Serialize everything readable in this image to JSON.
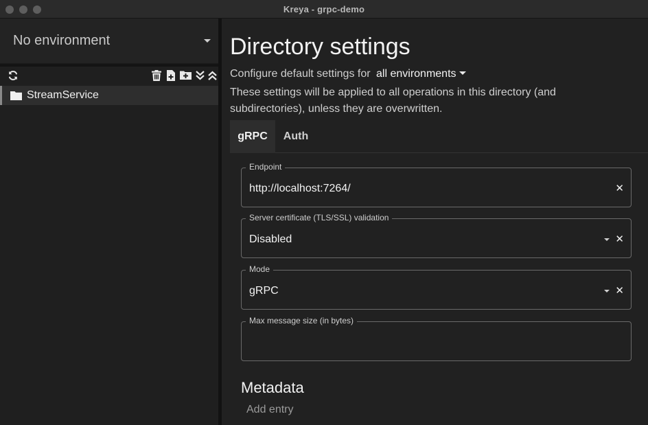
{
  "window": {
    "title": "Kreya - grpc-demo"
  },
  "sidebar": {
    "environment_label": "No environment",
    "toolbar_icons": [
      "refresh-icon",
      "delete-icon",
      "new-file-icon",
      "new-folder-icon",
      "collapse-all-icon",
      "expand-all-icon"
    ],
    "tree": [
      {
        "label": "StreamService",
        "icon": "folder-icon"
      }
    ]
  },
  "main": {
    "title": "Directory settings",
    "configure_prefix": "Configure default settings for",
    "configure_env": "all environments",
    "description": "These settings will be applied to all operations in this directory (and subdirectories), unless they are overwritten.",
    "tabs": [
      {
        "label": "gRPC",
        "active": true
      },
      {
        "label": "Auth",
        "active": false
      }
    ],
    "fields": {
      "endpoint": {
        "label": "Endpoint",
        "value": "http://localhost:7264/"
      },
      "certificate": {
        "label": "Server certificate (TLS/SSL) validation",
        "value": "Disabled"
      },
      "mode": {
        "label": "Mode",
        "value": "gRPC"
      },
      "max_message": {
        "label": "Max message size (in bytes)",
        "value": ""
      }
    },
    "metadata": {
      "title": "Metadata",
      "add_entry": "Add entry"
    }
  }
}
